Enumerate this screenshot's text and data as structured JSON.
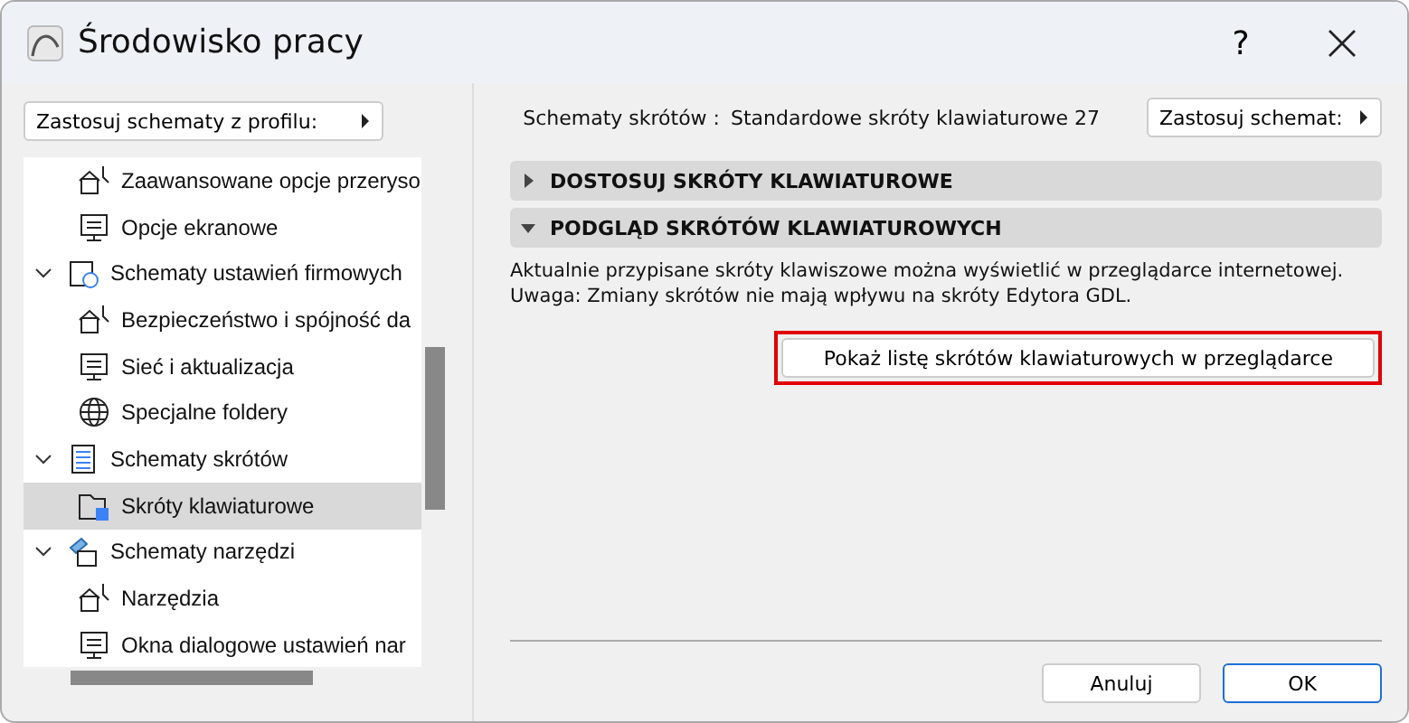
{
  "window": {
    "title": "Środowisko pracy",
    "help": "?"
  },
  "profile_menu": {
    "label": "Zastosuj schematy z profilu:"
  },
  "scheme": {
    "label": "Schematy skrótów :",
    "value": "Standardowe skróty klawiaturowe 27",
    "menu": "Zastosuj schemat:"
  },
  "tree": {
    "continued_items": [
      {
        "label": "Zaawansowane opcje przeryso",
        "selected": false
      },
      {
        "label": "Opcje ekranowe",
        "selected": false
      }
    ],
    "groups": [
      {
        "label": "Schematy ustawień firmowych",
        "expanded": true,
        "children": [
          {
            "label": "Bezpieczeństwo i spójność da",
            "selected": false
          },
          {
            "label": "Sieć i aktualizacja",
            "selected": false
          },
          {
            "label": "Specjalne foldery",
            "selected": false
          }
        ]
      },
      {
        "label": "Schematy skrótów",
        "expanded": true,
        "children": [
          {
            "label": "Skróty klawiaturowe",
            "selected": true
          }
        ]
      },
      {
        "label": "Schematy narzędzi",
        "expanded": true,
        "children": [
          {
            "label": "Narzędzia",
            "selected": false
          },
          {
            "label": "Okna dialogowe ustawień nar",
            "selected": false
          }
        ]
      }
    ]
  },
  "sections": [
    {
      "title": "DOSTOSUJ SKRÓTY KLAWIATUROWE",
      "expanded": false
    },
    {
      "title": "PODGLĄD SKRÓTÓW KLAWIATUROWYCH",
      "expanded": true,
      "text": "Aktualnie przypisane skróty klawiszowe można wyświetlić w przeglądarce internetowej.\nUwaga: Zmiany skrótów nie mają wpływu na skróty Edytora GDL.",
      "button": "Pokaż listę skrótów klawiaturowych w przeglądarce",
      "highlighted": true
    }
  ],
  "buttons": [
    {
      "label": "Anuluj",
      "default": false
    },
    {
      "label": "OK",
      "default": true
    }
  ]
}
